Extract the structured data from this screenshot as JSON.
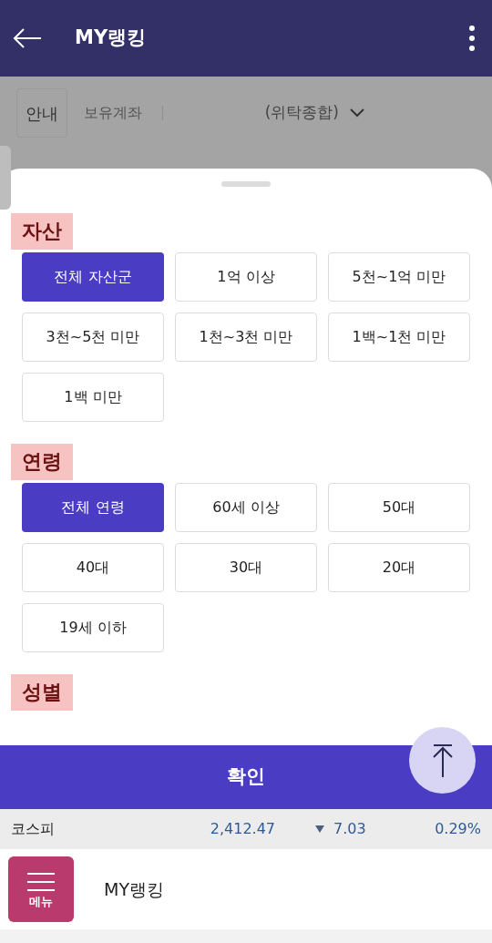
{
  "header": {
    "title": "MY랭킹"
  },
  "account_bar": {
    "info_button": "안내",
    "label": "보유계좌",
    "account": "(위탁종합)"
  },
  "sections": [
    {
      "title": "자산",
      "options": [
        {
          "label": "전체 자산군",
          "selected": true
        },
        {
          "label": "1억 이상",
          "selected": false
        },
        {
          "label": "5천~1억 미만",
          "selected": false
        },
        {
          "label": "3천~5천 미만",
          "selected": false
        },
        {
          "label": "1천~3천 미만",
          "selected": false
        },
        {
          "label": "1백~1천 미만",
          "selected": false
        },
        {
          "label": "1백 미만",
          "selected": false
        }
      ]
    },
    {
      "title": "연령",
      "options": [
        {
          "label": "전체 연령",
          "selected": true
        },
        {
          "label": "60세 이상",
          "selected": false
        },
        {
          "label": "50대",
          "selected": false
        },
        {
          "label": "40대",
          "selected": false
        },
        {
          "label": "30대",
          "selected": false
        },
        {
          "label": "20대",
          "selected": false
        },
        {
          "label": "19세 이하",
          "selected": false
        }
      ]
    },
    {
      "title": "성별"
    }
  ],
  "confirm_button": "확인",
  "ticker": {
    "name": "코스피",
    "value": "2,412.47",
    "falling": true,
    "change": "7.03",
    "rate": "0.29%"
  },
  "bottom_nav": {
    "menu_label": "메뉴",
    "page_title": "MY랭킹"
  }
}
